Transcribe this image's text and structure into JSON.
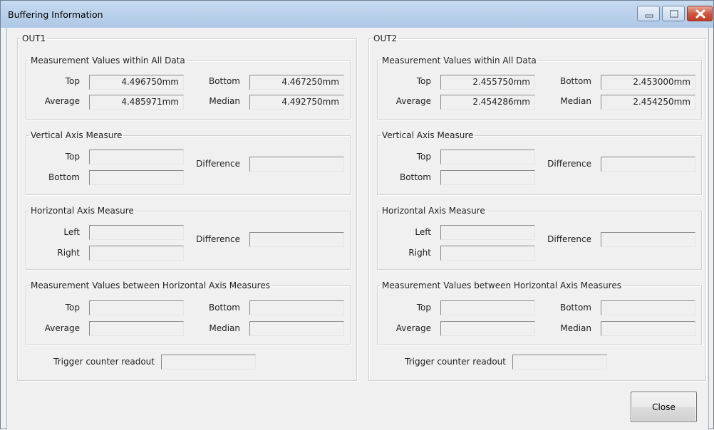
{
  "window": {
    "title": "Buffering Information",
    "controls": {
      "minimize": "minimize-icon",
      "maximize": "restore-icon",
      "close": "close-icon"
    }
  },
  "out1": {
    "legend": "OUT1",
    "all_data": {
      "legend": "Measurement Values within All Data",
      "top_label": "Top",
      "top_value": "4.496750mm",
      "bottom_label": "Bottom",
      "bottom_value": "4.467250mm",
      "average_label": "Average",
      "average_value": "4.485971mm",
      "median_label": "Median",
      "median_value": "4.492750mm"
    },
    "vertical": {
      "legend": "Vertical Axis Measure",
      "top_label": "Top",
      "top_value": "",
      "bottom_label": "Bottom",
      "bottom_value": "",
      "difference_label": "Difference",
      "difference_value": ""
    },
    "horizontal": {
      "legend": "Horizontal Axis Measure",
      "left_label": "Left",
      "left_value": "",
      "right_label": "Right",
      "right_value": "",
      "difference_label": "Difference",
      "difference_value": ""
    },
    "between": {
      "legend": "Measurement Values between Horizontal Axis Measures",
      "top_label": "Top",
      "top_value": "",
      "bottom_label": "Bottom",
      "bottom_value": "",
      "average_label": "Average",
      "average_value": "",
      "median_label": "Median",
      "median_value": ""
    },
    "trigger_label": "Trigger counter readout",
    "trigger_value": ""
  },
  "out2": {
    "legend": "OUT2",
    "all_data": {
      "legend": "Measurement Values within All Data",
      "top_label": "Top",
      "top_value": "2.455750mm",
      "bottom_label": "Bottom",
      "bottom_value": "2.453000mm",
      "average_label": "Average",
      "average_value": "2.454286mm",
      "median_label": "Median",
      "median_value": "2.454250mm"
    },
    "vertical": {
      "legend": "Vertical Axis Measure",
      "top_label": "Top",
      "top_value": "",
      "bottom_label": "Bottom",
      "bottom_value": "",
      "difference_label": "Difference",
      "difference_value": ""
    },
    "horizontal": {
      "legend": "Horizontal Axis Measure",
      "left_label": "Left",
      "left_value": "",
      "right_label": "Right",
      "right_value": "",
      "difference_label": "Difference",
      "difference_value": ""
    },
    "between": {
      "legend": "Measurement Values between Horizontal Axis Measures",
      "top_label": "Top",
      "top_value": "",
      "bottom_label": "Bottom",
      "bottom_value": "",
      "average_label": "Average",
      "average_value": "",
      "median_label": "Median",
      "median_value": ""
    },
    "trigger_label": "Trigger counter readout",
    "trigger_value": ""
  },
  "close_button": {
    "label": "Close"
  }
}
